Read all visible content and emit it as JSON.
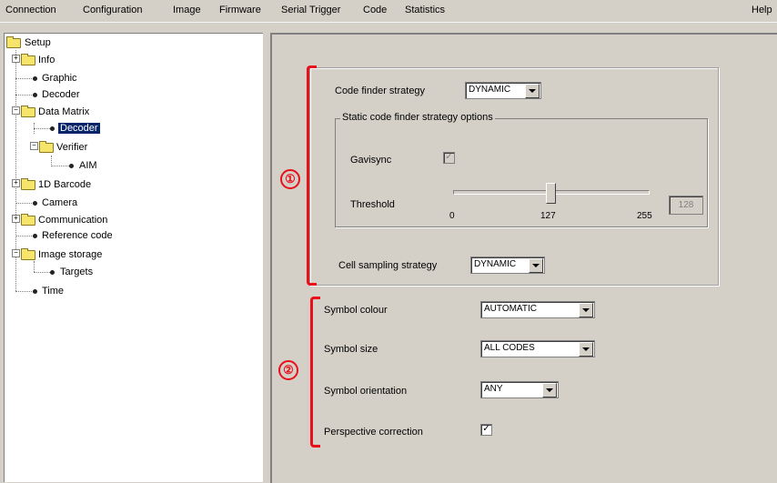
{
  "menu": {
    "items": [
      "Connection",
      "Configuration",
      "Image",
      "Firmware",
      "Serial Trigger",
      "Code",
      "Statistics"
    ],
    "help": "Help"
  },
  "tree": {
    "root": "Setup",
    "nodes": [
      "Info",
      "Graphic",
      "Decoder",
      "Data Matrix",
      "Decoder",
      "Verifier",
      "AIM",
      "1D Barcode",
      "Camera",
      "Communication",
      "Reference code",
      "Image storage",
      "Targets",
      "Time"
    ],
    "selected": "Decoder"
  },
  "section1": {
    "marker": "①",
    "code_finder_label": "Code finder strategy",
    "code_finder_value": "DYNAMIC",
    "static_group_title": "Static code finder strategy options",
    "gavisync_label": "Gavisync",
    "gavisync_checked": true,
    "threshold_label": "Threshold",
    "threshold_min": "0",
    "threshold_mid": "127",
    "threshold_max": "255",
    "threshold_value": "128",
    "cell_sampling_label": "Cell sampling strategy",
    "cell_sampling_value": "DYNAMIC"
  },
  "section2": {
    "marker": "②",
    "symbol_colour_label": "Symbol colour",
    "symbol_colour_value": "AUTOMATIC",
    "symbol_size_label": "Symbol size",
    "symbol_size_value": "ALL CODES",
    "symbol_orientation_label": "Symbol orientation",
    "symbol_orientation_value": "ANY",
    "perspective_label": "Perspective correction",
    "perspective_checked": true
  },
  "colors": {
    "annotation": "#e8101a",
    "selection": "#0a246a",
    "panel": "#d4d0c8"
  }
}
